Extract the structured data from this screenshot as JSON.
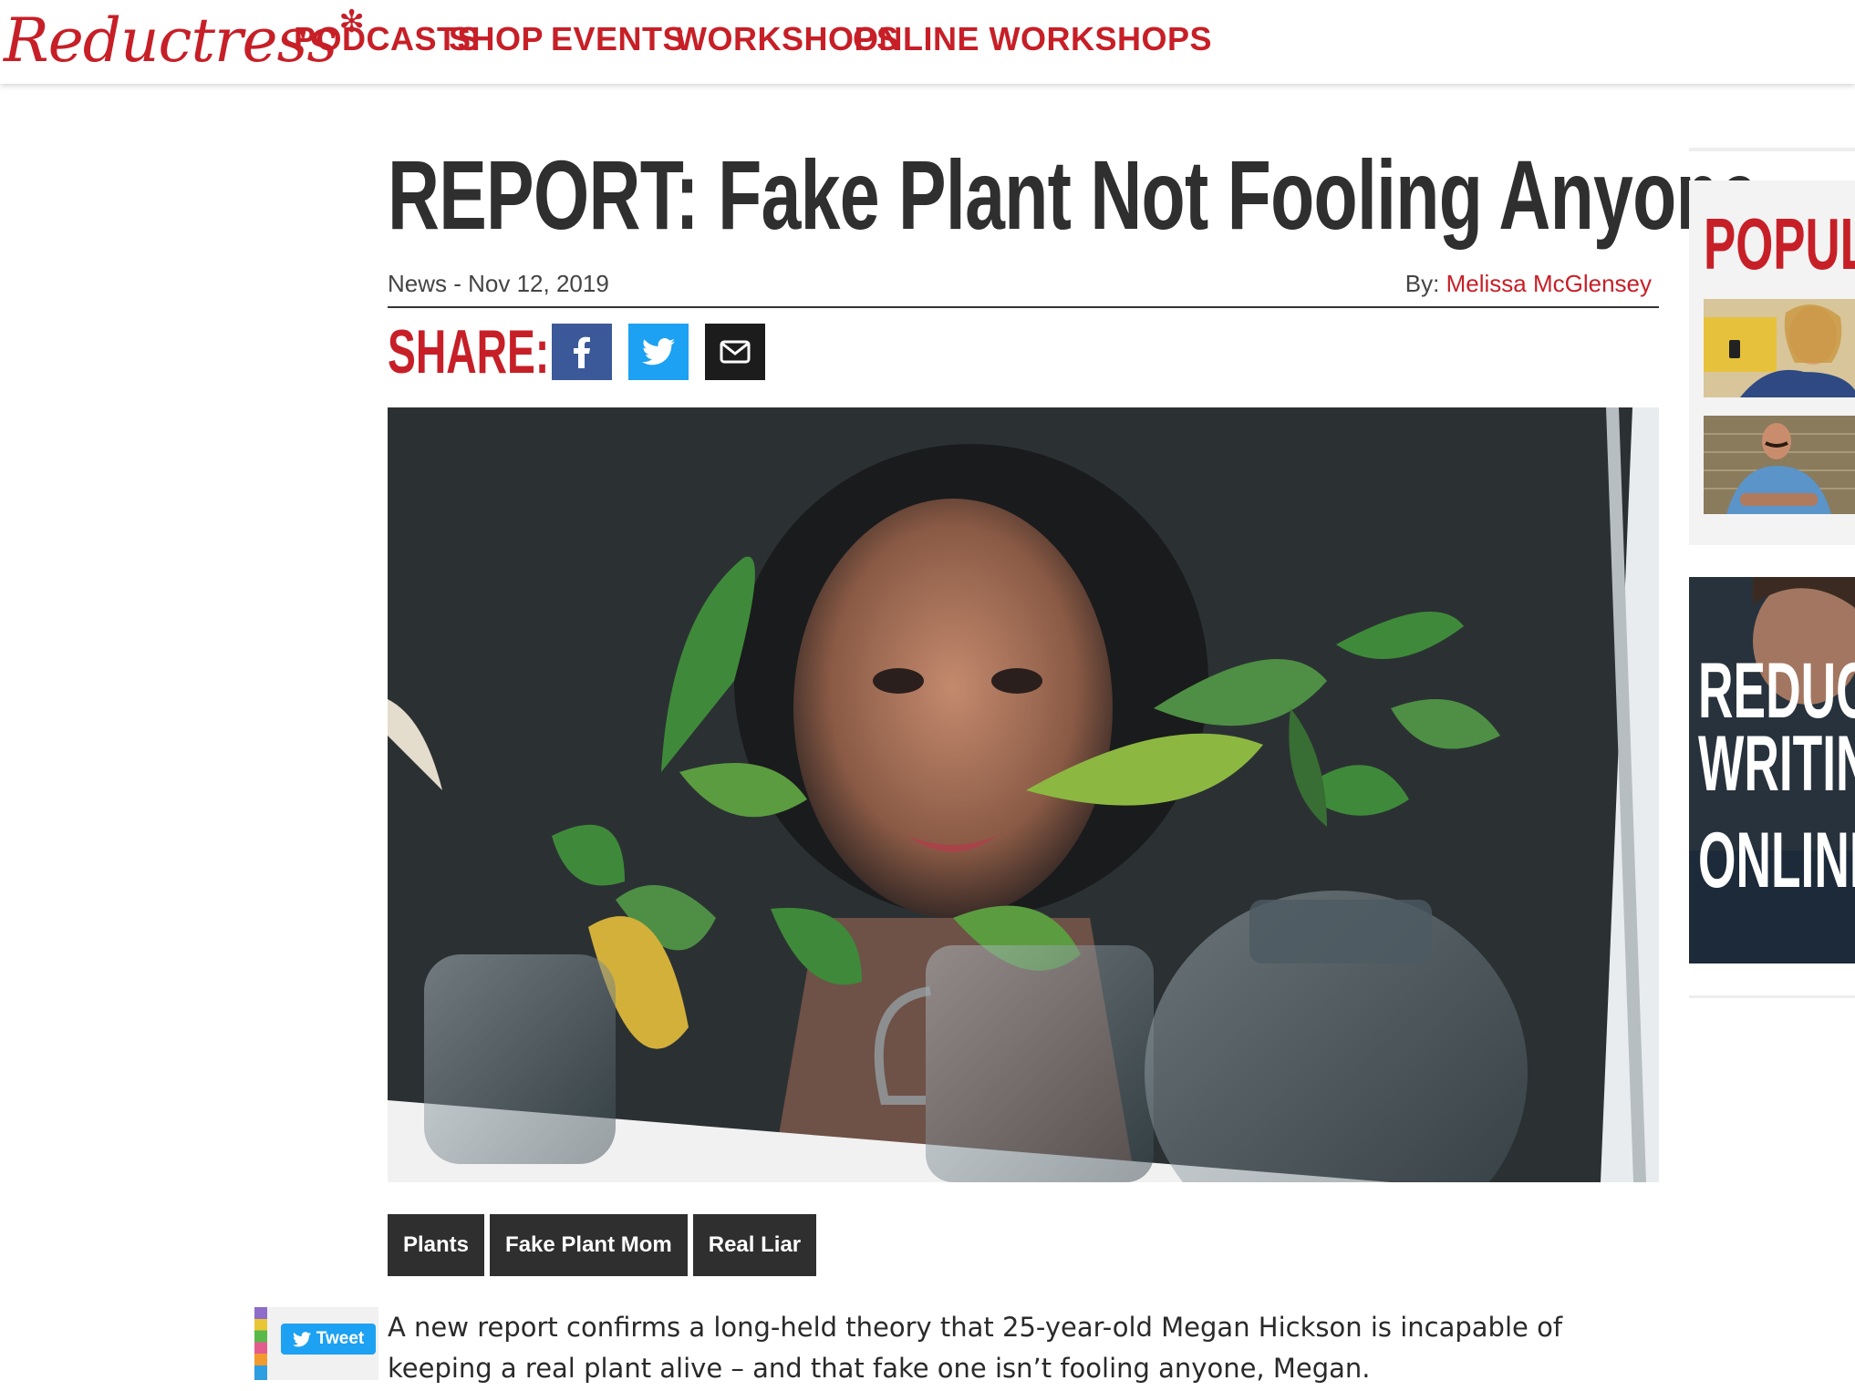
{
  "site": {
    "logo_text": "Reductress"
  },
  "nav": {
    "items": [
      "PODCASTS",
      "SHOP",
      "EVENTS",
      "WORKSHOPS",
      "ONLINE WORKSHOPS"
    ]
  },
  "article": {
    "headline": "REPORT: Fake Plant Not Fooling Anyone",
    "category_date": "News - Nov 12, 2019",
    "byline_prefix": "By:",
    "author": "Melissa McGlensey",
    "share_label": "SHARE:",
    "tags": [
      "Plants",
      "Fake Plant Mom",
      "Real Liar"
    ],
    "body": "A new report confirms a long-held theory that 25-year-old Megan Hickson is incapable of keeping a real plant alive – and that fake one isn’t fooling anyone, Megan."
  },
  "tweet": {
    "label": "Tweet"
  },
  "sidebar": {
    "popular_title": "POPULA",
    "promo_lines": [
      "REDUCT",
      "WRITIN",
      "ONLINE"
    ]
  },
  "colors": {
    "brand_red": "#c71f27",
    "facebook": "#3b5998",
    "twitter": "#1da1f2",
    "dark": "#2f2f2f"
  },
  "icons": [
    "flower-icon",
    "facebook-icon",
    "twitter-icon",
    "email-icon"
  ]
}
